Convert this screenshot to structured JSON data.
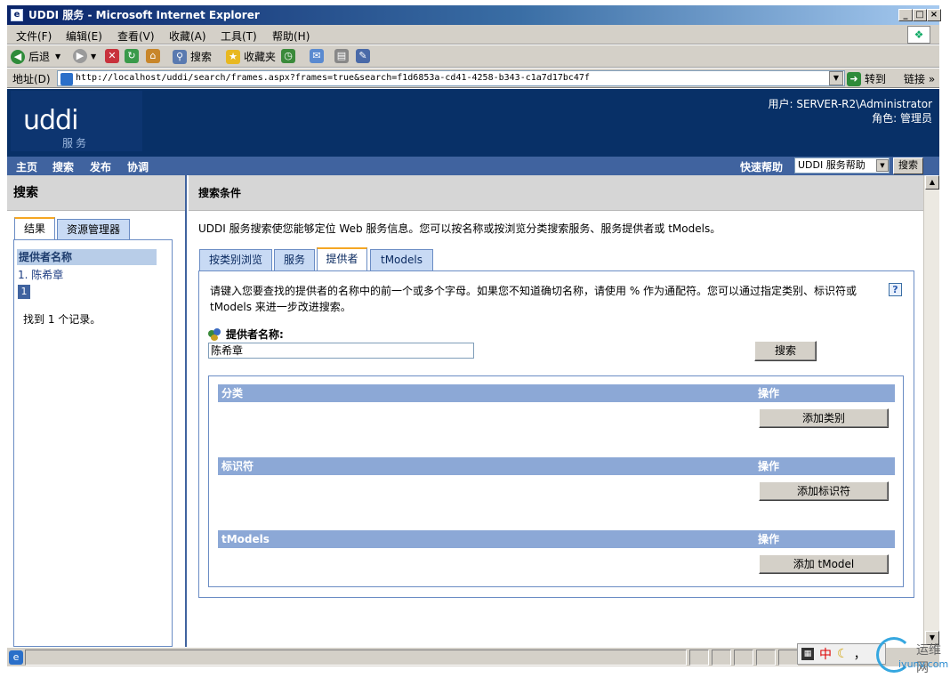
{
  "window": {
    "title": "UDDI 服务 - Microsoft Internet Explorer",
    "btn_min": "_",
    "btn_max": "□",
    "btn_close": "×"
  },
  "menu": [
    "文件(F)",
    "编辑(E)",
    "查看(V)",
    "收藏(A)",
    "工具(T)",
    "帮助(H)"
  ],
  "toolbar": {
    "back": "后退",
    "search": "搜索",
    "favorites": "收藏夹"
  },
  "address": {
    "label": "地址(D)",
    "url": "http://localhost/uddi/search/frames.aspx?frames=true&search=f1d6853a-cd41-4258-b343-c1a7d17bc47f",
    "goto": "转到",
    "links": "链接"
  },
  "banner": {
    "logo": "uddi",
    "logo_sub": "服务",
    "user": "用户: SERVER-R2\\Administrator",
    "role": "角色: 管理员"
  },
  "nav": {
    "items": [
      "主页",
      "搜索",
      "发布",
      "协调"
    ],
    "quickhelp_label": "快速帮助",
    "quickhelp_value": "UDDI 服务帮助",
    "quickhelp_button": "搜索"
  },
  "left": {
    "title": "搜索",
    "tabs": [
      "结果",
      "资源管理器"
    ],
    "list_header": "提供者名称",
    "list_item": "1. 陈希章",
    "page": "1",
    "found": "找到 1 个记录。"
  },
  "right": {
    "title": "搜索条件",
    "intro": "UDDI 服务搜索使您能够定位 Web 服务信息。您可以按名称或按浏览分类搜索服务、服务提供者或 tModels。",
    "tabs": [
      "按类别浏览",
      "服务",
      "提供者",
      "tModels"
    ],
    "instructions": "请键入您要查找的提供者的名称中的前一个或多个字母。如果您不知道确切名称，请使用 % 作为通配符。您可以通过指定类别、标识符或 tModels 来进一步改进搜索。",
    "provider_label": "提供者名称:",
    "provider_value": "陈希章",
    "search_button": "搜索",
    "sections": [
      {
        "title": "分类",
        "op": "操作",
        "button": "添加类别"
      },
      {
        "title": "标识符",
        "op": "操作",
        "button": "添加标识符"
      },
      {
        "title": "tModels",
        "op": "操作",
        "button": "添加 tModel"
      }
    ]
  },
  "status": {
    "ime": "中",
    "watermark1": "运维网",
    "watermark2": "iyunv.com"
  }
}
